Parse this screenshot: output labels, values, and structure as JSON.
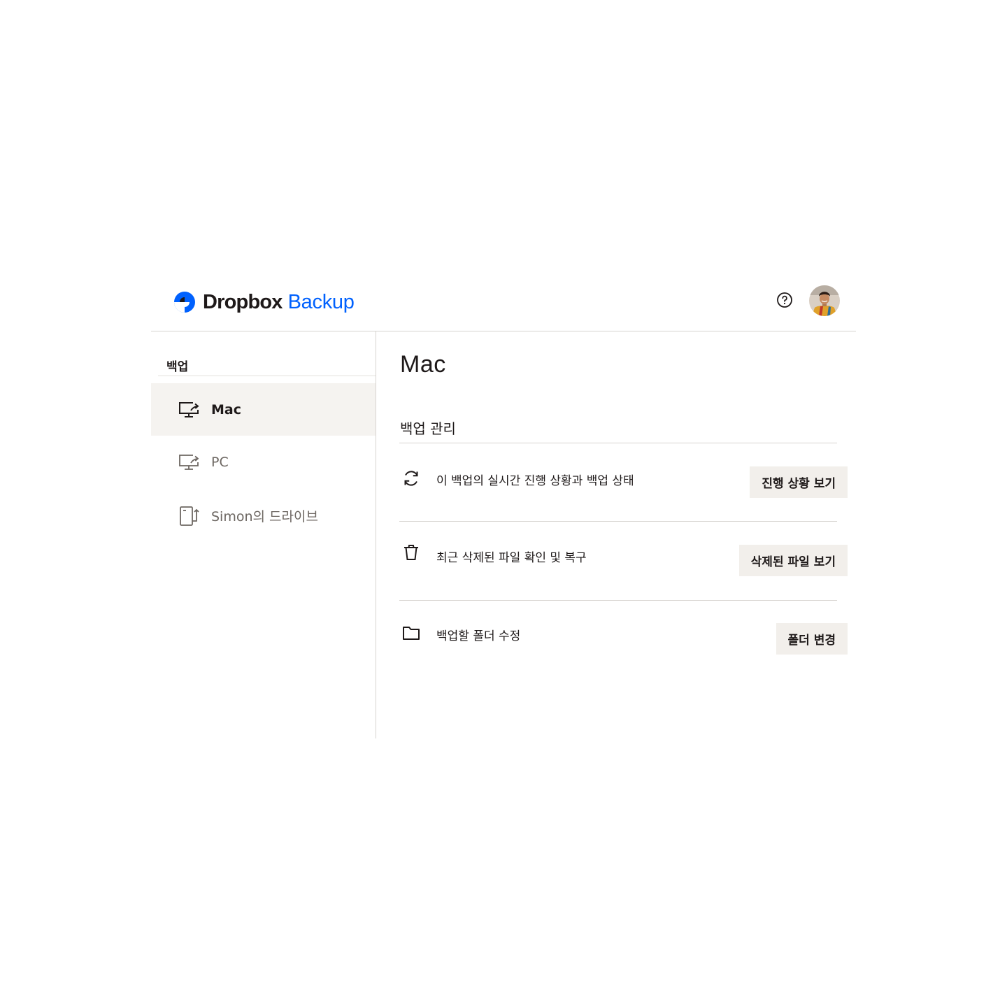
{
  "header": {
    "brand": "Dropbox",
    "product": "Backup",
    "brand_color": "#0061fe",
    "help_icon": "help-circle-icon"
  },
  "sidebar": {
    "heading": "백업",
    "items": [
      {
        "label": "Mac",
        "icon": "desktop-backup-icon",
        "active": true
      },
      {
        "label": "PC",
        "icon": "desktop-backup-icon",
        "active": false
      },
      {
        "label": "Simon의 드라이브",
        "icon": "external-drive-icon",
        "active": false
      }
    ]
  },
  "main": {
    "title": "Mac",
    "section_title": "백업 관리",
    "rows": [
      {
        "icon": "sync-icon",
        "text": "이 백업의 실시간 진행 상황과 백업 상태",
        "button": "진행 상황 보기"
      },
      {
        "icon": "trash-icon",
        "text": "최근 삭제된 파일 확인 및 복구",
        "button": "삭제된 파일 보기"
      },
      {
        "icon": "folder-icon",
        "text": "백업할 폴더 수정",
        "button": "폴더 변경"
      }
    ]
  }
}
